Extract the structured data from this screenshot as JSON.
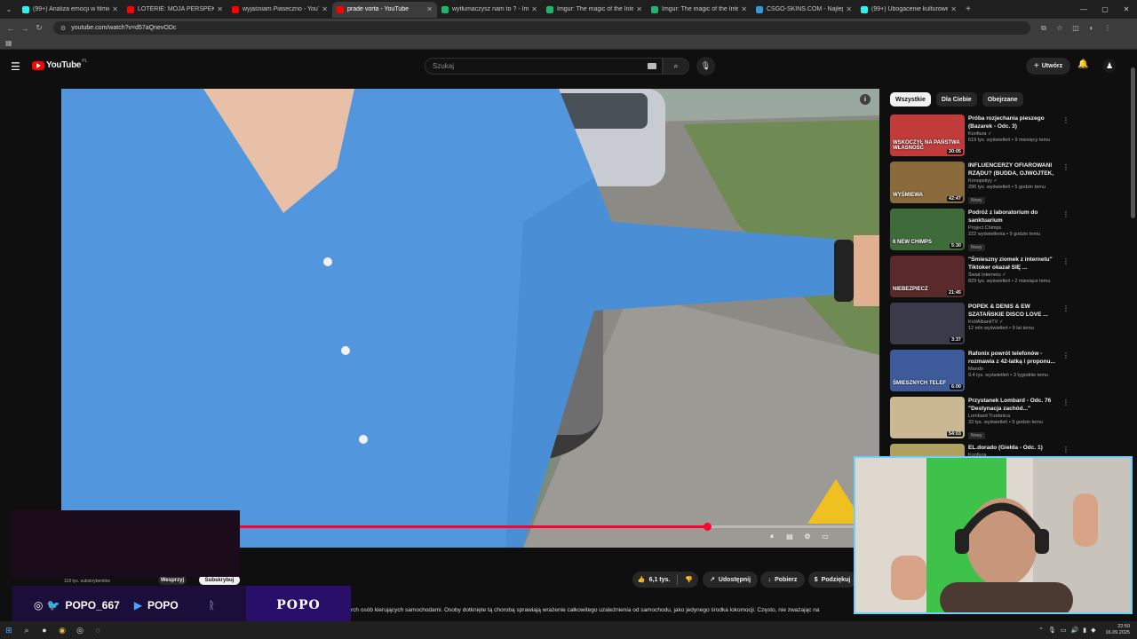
{
  "browser": {
    "tabs": [
      {
        "label": "(99+) Analiza emocji w filmie - ",
        "color": "#25f4ee",
        "active": false
      },
      {
        "label": "LOTERIE: MOJA PERSPEKTYWA",
        "color": "#ff0000",
        "active": false
      },
      {
        "label": "wyjaśniam Piaseczno - YouTube",
        "color": "#ff0000",
        "active": false
      },
      {
        "label": "prade vorta - YouTube",
        "color": "#ff0000",
        "active": true
      },
      {
        "label": "wytłumaczysz nam to ? - Imgur",
        "color": "#1bb76e",
        "active": false
      },
      {
        "label": "Imgur: The magic of the Intern",
        "color": "#1bb76e",
        "active": false
      },
      {
        "label": "Imgur: The magic of the Intern",
        "color": "#1bb76e",
        "active": false
      },
      {
        "label": "CSGO-SKINS.COM - Najlepsze",
        "color": "#2d9cdb",
        "active": false
      },
      {
        "label": "(99+) Ubogacenie kulturowe w",
        "color": "#25f4ee",
        "active": false
      }
    ],
    "url": "youtube.com/watch?v=d57aQnevODc"
  },
  "youtube": {
    "logo_text": "YouTube",
    "region": "PL",
    "search_placeholder": "Szukaj",
    "create_label": "Utwórz",
    "chips": [
      {
        "label": "Wszystkie",
        "active": true
      },
      {
        "label": "Dla Ciebie",
        "active": false
      },
      {
        "label": "Obejrzane",
        "active": false
      }
    ],
    "recommendations": [
      {
        "title": "Próba rozjechania pieszego (Bazarek - Odc. 3)",
        "channel": "Konfiura",
        "verified": true,
        "stats": "619 tys. wyświetleń • 9 miesięcy temu",
        "duration": "30:05",
        "thumb_text": "WSKOCZYŁ NA PAŃSTWA WŁASNOŚĆ",
        "thumb_color": "#c13b3b",
        "badge": ""
      },
      {
        "title": "INFLUENCERZY OFIAROWANI RZĄDU? (BUDDA, OJWOJTEK, ...",
        "channel": "Konopskyy",
        "verified": true,
        "stats": "296 tys. wyświetleń • 5 godzin temu",
        "duration": "42:47",
        "thumb_text": "WYŚMIEWA",
        "thumb_color": "#8a6a3a",
        "badge": "Nowy"
      },
      {
        "title": "Podróż z laboratorium do sanktuarium",
        "channel": "Project Chimps",
        "verified": false,
        "stats": "222 wyświetlenia • 9 godzin temu",
        "duration": "5:30",
        "thumb_text": "6 NEW CHIMPS",
        "thumb_color": "#3f6b3a",
        "badge": "Nowy"
      },
      {
        "title": "\"Śmieszny ziomek z internetu\" Tiktoker okazał SIĘ ...",
        "channel": "Świat Internetu",
        "verified": true,
        "stats": "829 tys. wyświetleń • 2 miesiące temu",
        "duration": "21:45",
        "thumb_text": "NIEBEZPIECZ",
        "thumb_color": "#5a2a2a",
        "badge": ""
      },
      {
        "title": "POPEK & DENIS & EW SZATAŃSKIE DISCO LOVE ...",
        "channel": "KrólAlbaniiTV",
        "verified": true,
        "stats": "12 mln wyświetleń • 9 lat temu",
        "duration": "3:37",
        "thumb_text": "",
        "thumb_color": "#3a3a4a",
        "badge": ""
      },
      {
        "title": "Rafonix powrót telefonów - rozmawia z 42-latką i proponu...",
        "channel": "Mando",
        "verified": false,
        "stats": "9,4 tys. wyświetleń • 3 tygodnie temu",
        "duration": "6:00",
        "thumb_text": "ŚMIESZNYCH TELEF",
        "thumb_color": "#3d5a9a",
        "badge": ""
      },
      {
        "title": "Przystanek Lombard - Odc. 76 \"Destynacja zachód...\"",
        "channel": "Lombard Trzebnica",
        "verified": false,
        "stats": "33 tys. wyświetleń • 9 godzin temu",
        "duration": "54:03",
        "thumb_text": "",
        "thumb_color": "#c9b892",
        "badge": "Nowy"
      },
      {
        "title": "EL.dorado (Giełda - Odc. 1)",
        "channel": "Konfiura",
        "verified": false,
        "stats": "",
        "duration": "",
        "thumb_text": "",
        "thumb_color": "#b0a060",
        "badge": ""
      }
    ],
    "player": {
      "progress_fraction": 0.73
    },
    "below": {
      "subscribers": "118 tys. subskrybentów",
      "join_label": "Wesprzyj",
      "subscribe_label": "Subskrybuj",
      "likes": "6,1 tys.",
      "share_label": "Udostępnij",
      "download_label": "Pobierz",
      "thanks_label": "Podziękuj"
    },
    "description": "rch osób kierujących samochodami. Osoby dotknięte tą chorobą sprawiają wrażenie całkowitego uzależnienia od samochodu, jako jedynego środka lokomocji. Często, nie zważając na"
  },
  "stream_overlay": {
    "handle": "POPO_667",
    "yt_name": "POPO",
    "brand": "POPO"
  },
  "taskbar": {
    "time": "22:50",
    "date": "16.09.2025"
  }
}
